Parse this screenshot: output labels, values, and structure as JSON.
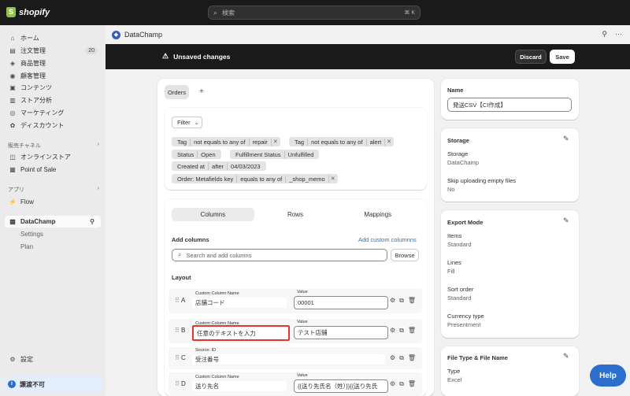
{
  "topbar": {
    "brand": "shopify",
    "search_placeholder": "検索",
    "search_shortcut": "⌘ K"
  },
  "sidebar": {
    "items": [
      {
        "label": "ホーム",
        "icon": "home-icon"
      },
      {
        "label": "注文管理",
        "icon": "orders-icon",
        "badge": "20"
      },
      {
        "label": "商品管理",
        "icon": "products-icon"
      },
      {
        "label": "顧客管理",
        "icon": "customers-icon"
      },
      {
        "label": "コンテンツ",
        "icon": "content-icon"
      },
      {
        "label": "ストア分析",
        "icon": "analytics-icon"
      },
      {
        "label": "マーケティング",
        "icon": "marketing-icon"
      },
      {
        "label": "ディスカウント",
        "icon": "discount-icon"
      }
    ],
    "sales_channels_label": "販売チャネル",
    "sales_channels": [
      {
        "label": "オンラインストア",
        "icon": "online-store-icon"
      },
      {
        "label": "Point of Sale",
        "icon": "pos-icon"
      }
    ],
    "apps_label": "アプリ",
    "apps": [
      {
        "label": "Flow",
        "icon": "flow-icon"
      }
    ],
    "active_app": {
      "label": "DataChamp",
      "icon": "datachamp-icon"
    },
    "active_app_sub": [
      "Settings",
      "Plan"
    ],
    "settings_label": "設定",
    "notice_label": "譲渡不可"
  },
  "appbar": {
    "title": "DataChamp"
  },
  "savebar": {
    "message": "Unsaved changes",
    "discard": "Discard",
    "save": "Save"
  },
  "main": {
    "tab_orders": "Orders",
    "tab_add": "+",
    "filter_label": "Filter",
    "filters": [
      [
        "Tag",
        "not equals to any of",
        "repair"
      ],
      [
        "Tag",
        "not equals to any of",
        "alert"
      ],
      [
        "Status",
        "Open"
      ],
      [
        "Fulfillment Status",
        "Unfulfilled"
      ],
      [
        "Created at",
        "after",
        "04/03/2023"
      ],
      [
        "Order: Metafields key",
        "equals to any of",
        "_shop_memo"
      ]
    ],
    "segments": [
      "Columns",
      "Rows",
      "Mappings"
    ],
    "add_columns_label": "Add columns",
    "add_custom_link": "Add custom columnns",
    "search_placeholder": "Search and add columns",
    "browse": "Browse",
    "layout_label": "Layout",
    "rows": [
      {
        "letter": "A",
        "name_label": "Custom Column Name",
        "name": "店舗コード",
        "value_label": "Value",
        "value": "00001"
      },
      {
        "letter": "B",
        "name_label": "Custom Column Name",
        "name": "任意のテキストを入力",
        "value_label": "Value",
        "value": "テスト店舗"
      },
      {
        "letter": "C",
        "name_label": "Source: ID",
        "name": "受注番号"
      },
      {
        "letter": "D",
        "name_label": "Custom Column Name",
        "name": "送り先名",
        "value_label": "Value",
        "value": "{{送り先氏名（姓）}}{{送り先氏"
      }
    ]
  },
  "right": {
    "name_title": "Name",
    "name_value": "発送CSV【CI作成】",
    "storage_title": "Storage",
    "storage_label": "Storage",
    "storage_value": "DataChamp",
    "skip_label": "Skip uploading empty files",
    "skip_value": "No",
    "export_title": "Export Mode",
    "items_label": "Items",
    "items_value": "Standard",
    "lines_label": "Lines",
    "lines_value": "Fill",
    "sort_label": "Sort order",
    "sort_value": "Standard",
    "currency_label": "Currency type",
    "currency_value": "Presentment",
    "filetype_title": "File Type & File Name",
    "type_label": "Type",
    "type_value": "Excel"
  },
  "help": "Help",
  "colors": {
    "topbar": "#1a1a1a",
    "accent": "#2c6ecb",
    "highlight": "#e2382b"
  }
}
